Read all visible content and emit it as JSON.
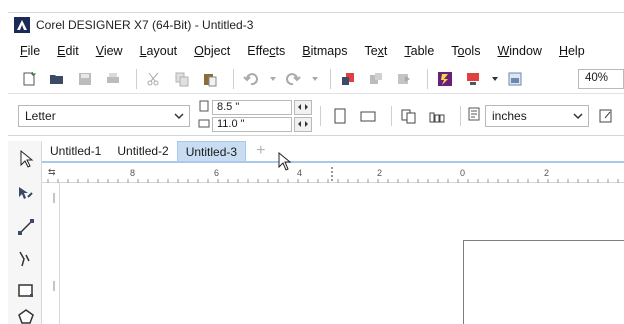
{
  "window": {
    "title": "Corel DESIGNER X7 (64-Bit) - Untitled-3"
  },
  "menu": [
    "File",
    "Edit",
    "View",
    "Layout",
    "Object",
    "Effects",
    "Bitmaps",
    "Text",
    "Table",
    "Tools",
    "Window",
    "Help"
  ],
  "menu_underline": [
    "F",
    "E",
    "V",
    "L",
    "O",
    "c",
    "B",
    "x",
    "T",
    "o",
    "W",
    "H"
  ],
  "toolbar": {
    "zoom": "40%",
    "icons": [
      "new-document-icon",
      "open-folder-icon",
      "save-icon",
      "print-icon",
      "cut-icon",
      "copy-icon",
      "paste-icon",
      "undo-icon",
      "redo-icon",
      "import-icon",
      "export-icon",
      "publish-icon",
      "app-launcher-icon",
      "options-icon",
      "view-icon"
    ]
  },
  "property_bar": {
    "page_size": "Letter",
    "width": "8.5 \"",
    "height": "11.0 \"",
    "units": "inches"
  },
  "tabs": [
    {
      "label": "Untitled-1",
      "active": false
    },
    {
      "label": "Untitled-2",
      "active": false
    },
    {
      "label": "Untitled-3",
      "active": true
    }
  ],
  "tools": [
    "pick-tool-icon",
    "shape-tool-icon",
    "line-tool-icon",
    "callout-tool-icon",
    "rectangle-tool-icon",
    "polygon-tool-icon"
  ],
  "ruler": {
    "marks": [
      "8",
      "6",
      "4",
      "2",
      "0",
      "2"
    ]
  },
  "colors": {
    "active_tab": "#c9ddf2",
    "tab_border": "#a9c9ea",
    "app_icon": "#1c2a57",
    "publish_purple": "#6a1f7a"
  }
}
